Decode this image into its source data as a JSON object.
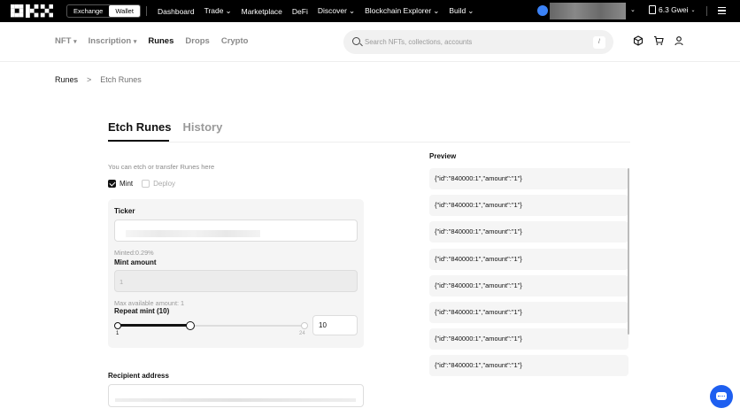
{
  "topbar": {
    "switch": {
      "exchange": "Exchange",
      "wallet": "Wallet"
    },
    "nav": [
      {
        "label": "Dashboard",
        "chevron": false
      },
      {
        "label": "Trade",
        "chevron": true
      },
      {
        "label": "Marketplace",
        "chevron": false
      },
      {
        "label": "DeFi",
        "chevron": false
      },
      {
        "label": "Discover",
        "chevron": true
      },
      {
        "label": "Blockchain Explorer",
        "chevron": true
      },
      {
        "label": "Build",
        "chevron": true
      }
    ],
    "gas": "6.3 Gwei"
  },
  "subnav": {
    "tabs": [
      {
        "label": "NFT",
        "chevron": true
      },
      {
        "label": "Inscription",
        "chevron": true
      },
      {
        "label": "Runes",
        "chevron": false
      },
      {
        "label": "Drops",
        "chevron": false
      },
      {
        "label": "Crypto",
        "chevron": false
      }
    ],
    "search_placeholder": "Search NFTs, collections, accounts",
    "search_shortcut": "/"
  },
  "breadcrumb": {
    "root": "Runes",
    "sep": ">",
    "current": "Etch Runes"
  },
  "main": {
    "tabs": {
      "active": "Etch Runes",
      "inactive": "History"
    },
    "hint": "You can etch or transfer Runes here",
    "mint_label": "Mint",
    "deploy_label": "Deploy",
    "ticker_label": "Ticker",
    "minted_text": "Minted:0.29%",
    "mint_amount_label": "Mint amount",
    "mint_amount_value": "1",
    "max_available": "Max available amount: 1",
    "repeat_label": "Repeat mint (10)",
    "slider_min": "1",
    "slider_max": "24",
    "repeat_value": "10",
    "slider_fraction": 0.39,
    "recipient_label": "Recipient address"
  },
  "preview": {
    "title": "Preview",
    "items": [
      "{\"id\":\"840000:1\",\"amount\":\"1\"}",
      "{\"id\":\"840000:1\",\"amount\":\"1\"}",
      "{\"id\":\"840000:1\",\"amount\":\"1\"}",
      "{\"id\":\"840000:1\",\"amount\":\"1\"}",
      "{\"id\":\"840000:1\",\"amount\":\"1\"}",
      "{\"id\":\"840000:1\",\"amount\":\"1\"}",
      "{\"id\":\"840000:1\",\"amount\":\"1\"}",
      "{\"id\":\"840000:1\",\"amount\":\"1\"}"
    ]
  }
}
